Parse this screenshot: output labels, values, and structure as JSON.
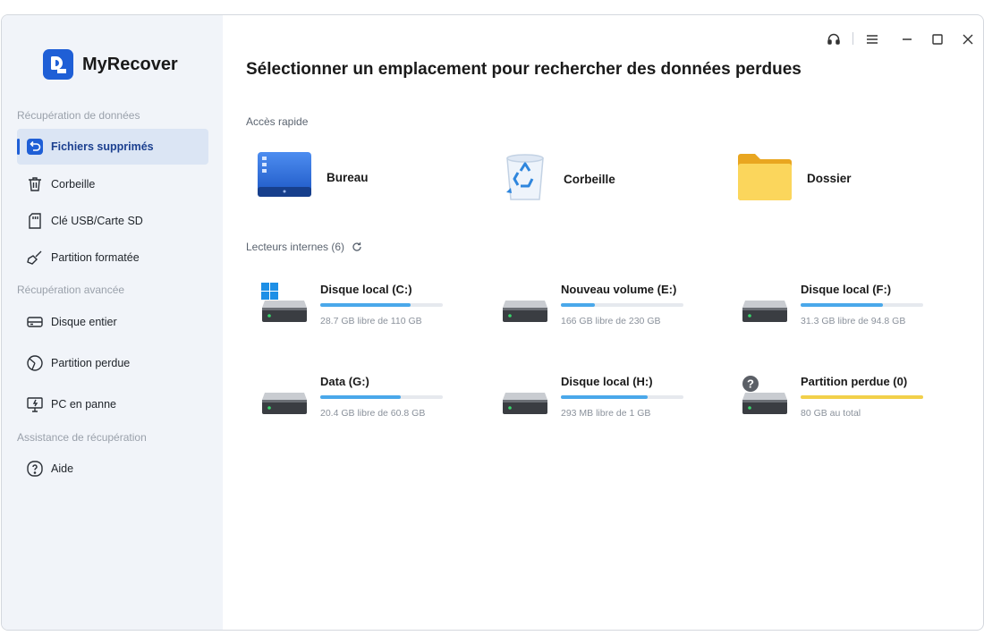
{
  "app": {
    "name": "MyRecover"
  },
  "sidebar": {
    "sections": [
      {
        "title": "Récupération de données"
      },
      {
        "title": "Récupération avancée"
      },
      {
        "title": "Assistance de récupération"
      }
    ],
    "items": [
      {
        "label": "Fichiers supprimés",
        "icon": "undo-icon",
        "active": true
      },
      {
        "label": "Corbeille",
        "icon": "trash-icon"
      },
      {
        "label": "Clé USB/Carte SD",
        "icon": "sd-card-icon"
      },
      {
        "label": "Partition formatée",
        "icon": "broom-icon"
      },
      {
        "label": "Disque entier",
        "icon": "hard-disk-icon"
      },
      {
        "label": "Partition perdue",
        "icon": "pie-partition-icon"
      },
      {
        "label": "PC en panne",
        "icon": "broken-pc-icon"
      },
      {
        "label": "Aide",
        "icon": "help-circle-icon"
      }
    ]
  },
  "main": {
    "title": "Sélectionner un emplacement pour rechercher des données perdues",
    "quick_access": {
      "label": "Accès rapide",
      "items": [
        {
          "label": "Bureau",
          "icon": "desktop-icon"
        },
        {
          "label": "Corbeille",
          "icon": "recycle-bin-icon"
        },
        {
          "label": "Dossier",
          "icon": "folder-icon"
        }
      ]
    },
    "internal_drives": {
      "label": "Lecteurs internes (6)",
      "drives": [
        {
          "name": "Disque local (C:)",
          "info": "28.7 GB libre de 110 GB",
          "used_fraction": 0.74,
          "color": "#4aa8ea",
          "icon": "windows-drive-icon"
        },
        {
          "name": "Nouveau volume (E:)",
          "info": "166 GB libre de 230 GB",
          "used_fraction": 0.28,
          "color": "#4aa8ea",
          "icon": "hard-drive-icon"
        },
        {
          "name": "Disque local (F:)",
          "info": "31.3 GB libre de 94.8 GB",
          "used_fraction": 0.67,
          "color": "#4aa8ea",
          "icon": "hard-drive-icon"
        },
        {
          "name": "Data (G:)",
          "info": "20.4 GB libre de 60.8 GB",
          "used_fraction": 0.66,
          "color": "#4aa8ea",
          "icon": "hard-drive-icon"
        },
        {
          "name": "Disque local (H:)",
          "info": "293 MB libre de 1 GB",
          "used_fraction": 0.71,
          "color": "#4aa8ea",
          "icon": "hard-drive-icon"
        },
        {
          "name": "Partition perdue (0)",
          "info": "80 GB au total",
          "used_fraction": 1.0,
          "color": "#f2d04a",
          "icon": "unknown-drive-icon"
        }
      ]
    }
  },
  "titlebar": {
    "buttons": [
      "headset-icon",
      "menu-icon",
      "minimize-icon",
      "maximize-icon",
      "close-icon"
    ]
  },
  "colors": {
    "accent": "#1f5fd6",
    "sidebar_bg": "#f1f4f9",
    "active_bg": "#dbe5f4"
  }
}
